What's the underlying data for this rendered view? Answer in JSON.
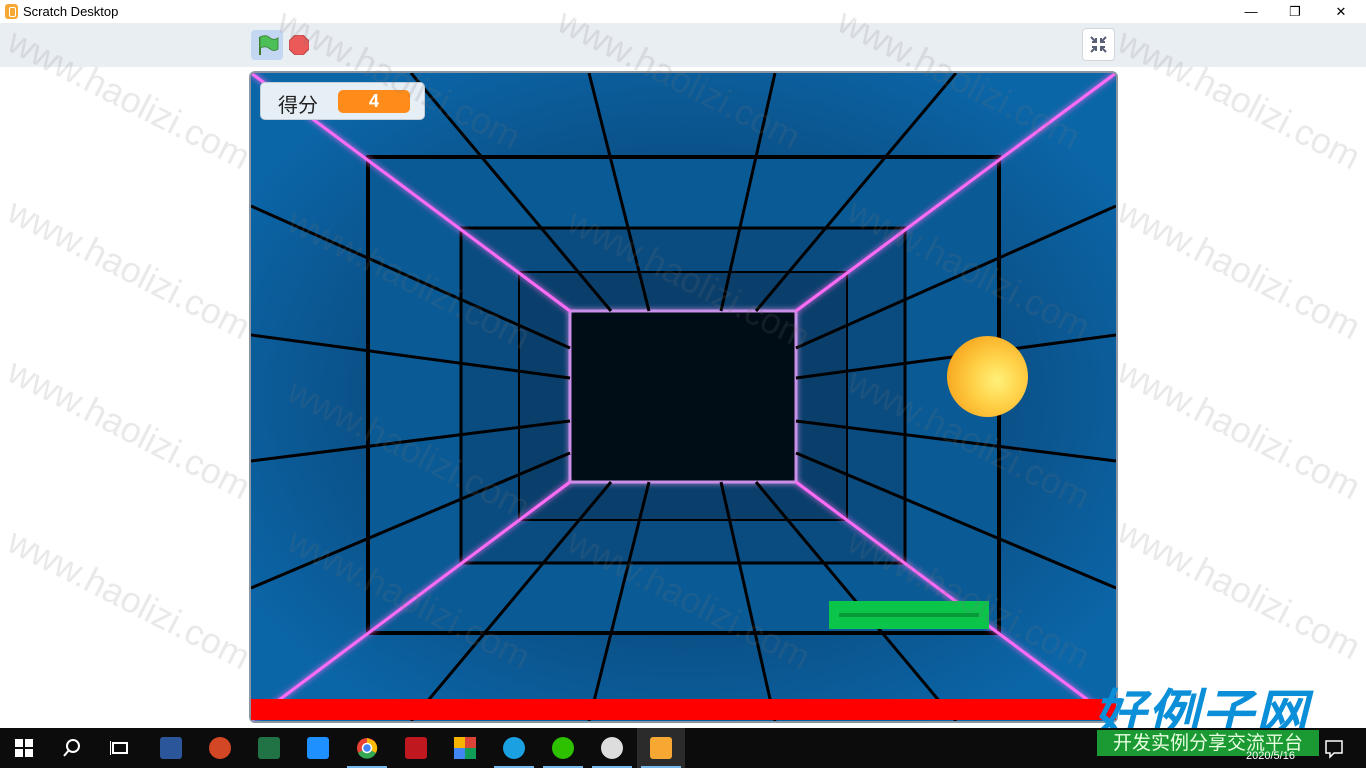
{
  "window": {
    "title": "Scratch Desktop",
    "minimize": "—",
    "restore": "❐",
    "close": "✕"
  },
  "toolbar": {
    "green_flag": "green-flag-icon",
    "stop": "stop-icon",
    "fullscreen": "exit-fullscreen-icon"
  },
  "stage": {
    "score_label": "得分",
    "score_value": "4",
    "colors": {
      "wall": "#0b66a8",
      "tunnel_end": "#061018",
      "neon": "#ff6cf5",
      "ball": "#ffc233",
      "paddle": "#0bc44a",
      "floor_bar": "#ff0000"
    }
  },
  "watermark": {
    "text": "www.haolizi.com",
    "brand": "好例子网",
    "brand_sub": "开发实例分享交流平台"
  },
  "taskbar": {
    "items": [
      {
        "name": "start-icon",
        "color": "#ffffff"
      },
      {
        "name": "search-icon",
        "color": "#ffffff"
      },
      {
        "name": "task-view-icon",
        "color": "#ffffff"
      },
      {
        "name": "word-icon",
        "color": "#2b579a"
      },
      {
        "name": "powerpoint-icon",
        "color": "#d24726"
      },
      {
        "name": "excel-icon",
        "color": "#217346"
      },
      {
        "name": "star-app-icon",
        "color": "#1e90ff"
      },
      {
        "name": "chrome-icon",
        "color": "#e94235"
      },
      {
        "name": "red-app-icon",
        "color": "#c0181f"
      },
      {
        "name": "colorful-app-icon",
        "color": "#f4b400"
      },
      {
        "name": "edge-ie-icon",
        "color": "#1ba1e2"
      },
      {
        "name": "wechat-icon",
        "color": "#2dc100"
      },
      {
        "name": "game-app-icon",
        "color": "#dddddd"
      },
      {
        "name": "scratch-icon",
        "color": "#f7a833"
      }
    ],
    "date": "2020/5/16"
  }
}
